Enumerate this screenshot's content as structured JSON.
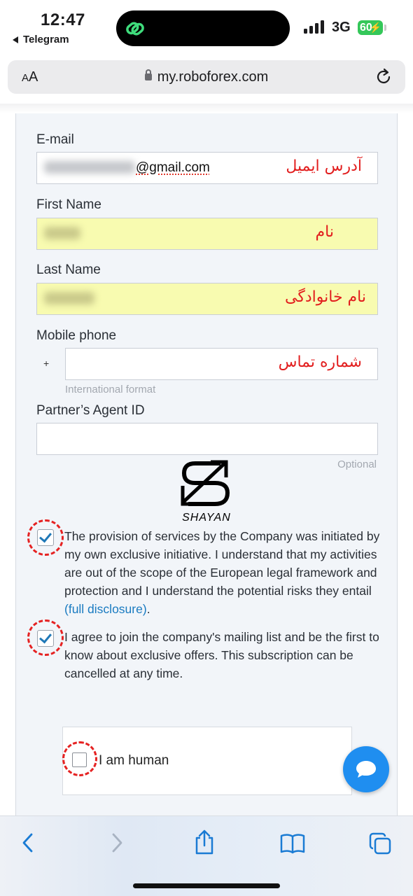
{
  "status": {
    "time": "12:47",
    "back_app": "Telegram",
    "network": "3G",
    "battery": "60"
  },
  "browser": {
    "text_size_label": "AA",
    "url": "my.roboforex.com"
  },
  "form": {
    "email": {
      "label": "E-mail",
      "value_suffix": "@gmail.com",
      "annotation": "آدرس ایمیل"
    },
    "first_name": {
      "label": "First Name",
      "annotation": "نام"
    },
    "last_name": {
      "label": "Last Name",
      "annotation": "نام خانوادگی"
    },
    "mobile": {
      "label": "Mobile phone",
      "prefix": "+",
      "annotation": "شماره تماس",
      "hint": "International format"
    },
    "agent_id": {
      "label": "Partner’s Agent ID",
      "hint": "Optional"
    }
  },
  "watermark": {
    "text": "SHAYAN"
  },
  "consents": {
    "provision": {
      "text": "The provision of services by the Company was initiated by my own exclusive initiative. I understand that my activities are out of the scope of the European legal framework and protection and I understand the potential risks they entail ",
      "link": "(full disclosure)",
      "tail": ".",
      "checked": true
    },
    "mailing": {
      "text": "I agree to join the company's mailing list and be the first to know about exclusive offers. This subscription can be cancelled at any time.",
      "checked": true
    }
  },
  "captcha": {
    "label": "I am human",
    "checked": false
  },
  "colors": {
    "accent": "#1a7bc1",
    "annotation": "#e21d1d",
    "autofill": "#f8fbb0",
    "chat": "#1f8ef0"
  },
  "icons": [
    "back-chevron-icon",
    "forward-chevron-icon",
    "share-icon",
    "bookmarks-icon",
    "tabs-icon",
    "chat-icon",
    "reload-icon",
    "lock-icon"
  ]
}
